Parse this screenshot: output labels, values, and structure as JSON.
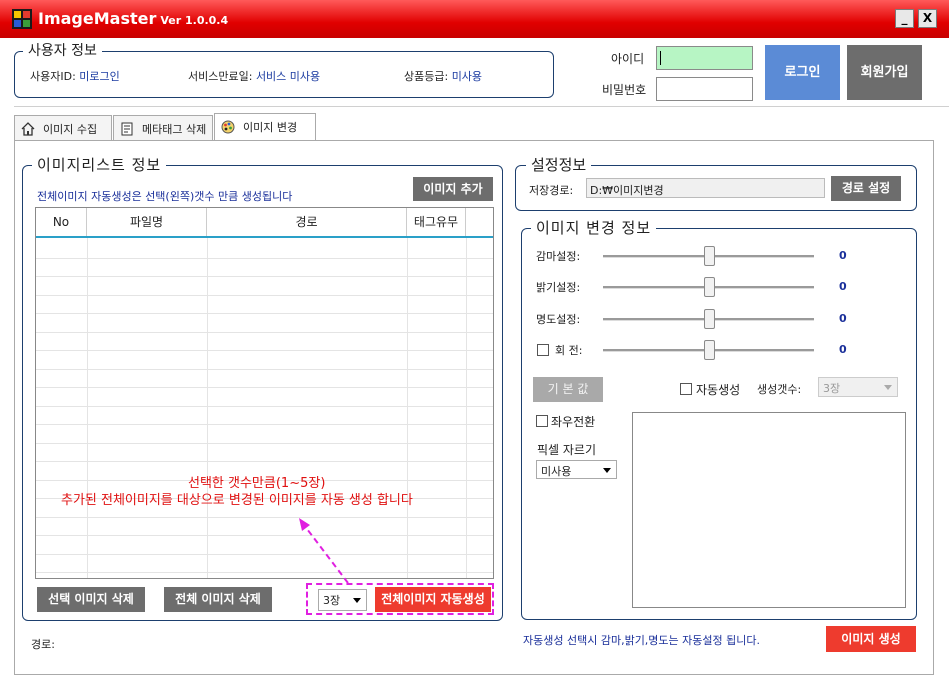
{
  "window": {
    "title": "ImageMaster",
    "version": "Ver 1.0.0.4",
    "minimize": "_",
    "close": "X"
  },
  "user_info": {
    "legend": "사용자 정보",
    "user_id_label": "사용자ID:",
    "user_id_value": "미로그인",
    "service_expiry_label": "서비스만료일:",
    "service_expiry_value": "서비스 미사용",
    "product_grade_label": "상품등급:",
    "product_grade_value": "미사용"
  },
  "login": {
    "id_label": "아이디",
    "password_label": "비밀번호",
    "id_value": "",
    "password_value": "",
    "login_button": "로그인",
    "signup_button": "회원가입",
    "colors": {
      "id_field_bg": "#b7f5c4",
      "login_button": "#5b8bd6",
      "signup_button": "#6d6d6d"
    }
  },
  "tabs": [
    {
      "label": "이미지 수집",
      "icon": "home-icon",
      "active": false
    },
    {
      "label": "메타태그 삭제",
      "icon": "document-icon",
      "active": false
    },
    {
      "label": "이미지 변경",
      "icon": "palette-icon",
      "active": true
    }
  ],
  "image_list": {
    "legend": "이미지리스트 정보",
    "note": "전체이미지 자동생성은 선택(왼쪽)갯수 만큼 생성됩니다",
    "add_button": "이미지 추가",
    "columns": [
      "No",
      "파일명",
      "경로",
      "태그유무"
    ],
    "rows": [],
    "overlay_line1": "선택한 갯수만큼(1~5장)",
    "overlay_line2": "추가된 전체이미지를 대상으로 변경된 이미지를 자동 생성 합니다",
    "delete_selected_button": "선택 이미지 삭제",
    "delete_all_button": "전체 이미지 삭제",
    "count_select": "3장",
    "auto_generate_button": "전체이미지 자동생성"
  },
  "path_label": "경로:",
  "settings": {
    "legend": "설정정보",
    "save_path_label": "저장경로:",
    "save_path_value": "D:₩이미지변경",
    "path_button": "경로 설정"
  },
  "image_change": {
    "legend": "이미지 변경 정보",
    "sliders": [
      {
        "label": "감마설정:",
        "value": "0",
        "level": 0.5,
        "checkbox": false
      },
      {
        "label": "밝기설정:",
        "value": "0",
        "level": 0.5,
        "checkbox": false
      },
      {
        "label": "명도설정:",
        "value": "0",
        "level": 0.5,
        "checkbox": false
      },
      {
        "label": "회   전:",
        "value": "0",
        "level": 0.5,
        "checkbox": true,
        "checked": false
      }
    ],
    "default_button": "기 본 값",
    "auto_generate_label": "자동생성",
    "auto_generate_checked": false,
    "gen_count_label": "생성갯수:",
    "gen_count_value": "3장",
    "mirror_label": "좌우전환",
    "mirror_checked": false,
    "pixel_crop_label": "픽셀 자르기",
    "pixel_crop_value": "미사용"
  },
  "footer_note": "자동생성 선택시 감마,밝기,명도는 자동설정 됩니다.",
  "generate_button": "이미지 생성"
}
